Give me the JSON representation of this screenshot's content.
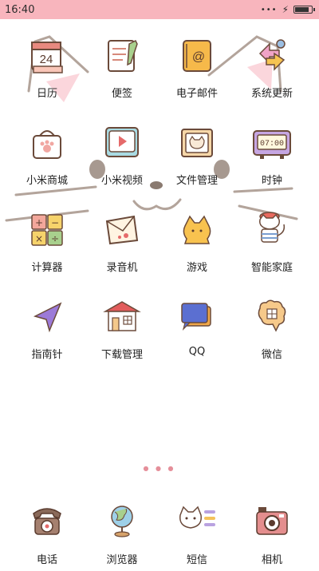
{
  "status_bar": {
    "time": "16:40"
  },
  "apps": [
    {
      "label": "日历",
      "icon": "calendar-icon",
      "date": "24"
    },
    {
      "label": "便签",
      "icon": "notes-icon"
    },
    {
      "label": "电子邮件",
      "icon": "email-icon"
    },
    {
      "label": "系统更新",
      "icon": "update-icon"
    },
    {
      "label": "小米商城",
      "icon": "shop-icon"
    },
    {
      "label": "小米视频",
      "icon": "video-icon"
    },
    {
      "label": "文件管理",
      "icon": "files-icon"
    },
    {
      "label": "时钟",
      "icon": "clock-icon",
      "time": "07:00"
    },
    {
      "label": "计算器",
      "icon": "calculator-icon"
    },
    {
      "label": "录音机",
      "icon": "recorder-icon"
    },
    {
      "label": "游戏",
      "icon": "game-icon"
    },
    {
      "label": "智能家庭",
      "icon": "smart-home-icon"
    },
    {
      "label": "指南针",
      "icon": "compass-icon"
    },
    {
      "label": "下载管理",
      "icon": "download-icon"
    },
    {
      "label": "QQ",
      "icon": "qq-icon"
    },
    {
      "label": "微信",
      "icon": "wechat-icon"
    }
  ],
  "dock": [
    {
      "label": "电话",
      "icon": "phone-icon"
    },
    {
      "label": "浏览器",
      "icon": "browser-icon"
    },
    {
      "label": "短信",
      "icon": "messages-icon"
    },
    {
      "label": "相机",
      "icon": "camera-icon"
    }
  ],
  "colors": {
    "status_bar": "#f8b5bd",
    "accent_pink": "#e58f9a"
  }
}
